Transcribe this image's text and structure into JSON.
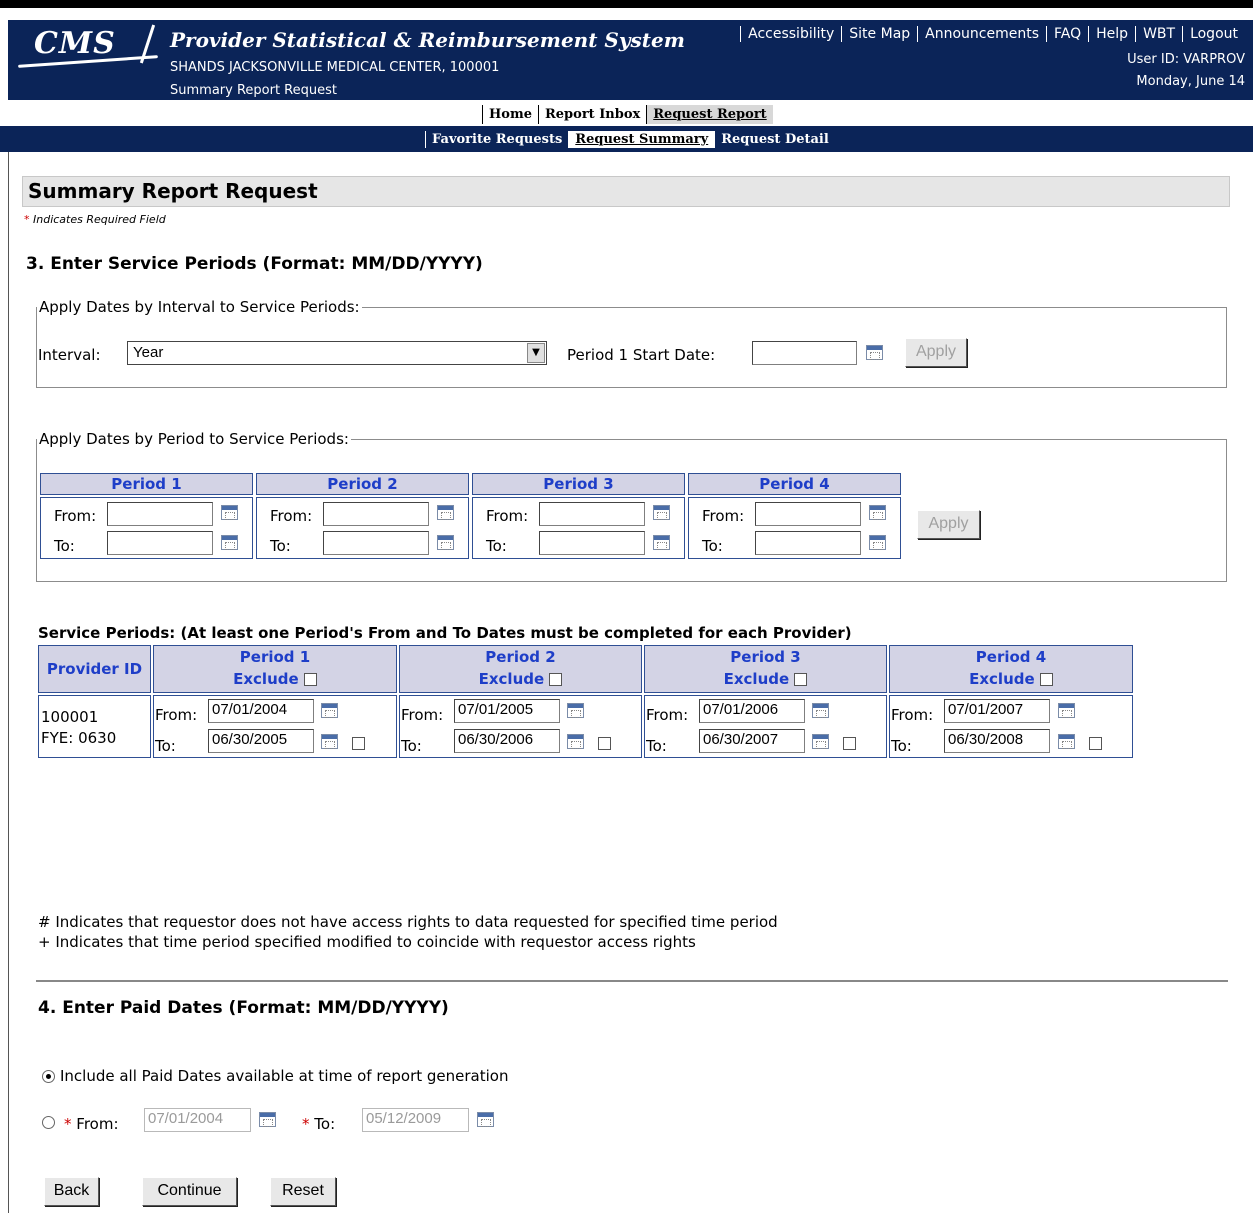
{
  "header": {
    "logo": "CMS",
    "app_title": "Provider Statistical & Reimbursement System",
    "facility": "SHANDS JACKSONVILLE MEDICAL CENTER, 100001",
    "crumb": "Summary Report Request",
    "util_links": [
      "Accessibility",
      "Site Map",
      "Announcements",
      "FAQ",
      "Help",
      "WBT",
      "Logout"
    ],
    "user_id": "User ID: VARPROV",
    "date": "Monday, June 14"
  },
  "nav1": [
    "Home",
    "Report Inbox",
    "Request Report"
  ],
  "nav2": [
    "Favorite Requests",
    "Request Summary",
    "Request Detail"
  ],
  "page": {
    "title": "Summary Report Request",
    "required_note": "Indicates Required Field",
    "section3": "3.  Enter Service Periods (Format: MM/DD/YYYY)",
    "interval_legend": "Apply Dates by Interval to Service Periods:",
    "interval_label": "Interval:",
    "interval_value": "Year",
    "period1_start_label": "Period 1 Start Date:",
    "apply_label": "Apply",
    "period_legend": "Apply Dates by Period to Service Periods:",
    "periods": [
      "Period 1",
      "Period 2",
      "Period 3",
      "Period 4"
    ],
    "from_label": "From:",
    "to_label": "To:",
    "service_periods_caption": "Service Periods: (At least one Period's From and To Dates must be completed for each Provider)",
    "provider_id_header": "Provider ID",
    "exclude_label": "Exclude",
    "provider_id": "100001",
    "fye": "FYE: 0630",
    "service_dates": [
      {
        "from": "07/01/2004",
        "to": "06/30/2005"
      },
      {
        "from": "07/01/2005",
        "to": "06/30/2006"
      },
      {
        "from": "07/01/2006",
        "to": "06/30/2007"
      },
      {
        "from": "07/01/2007",
        "to": "06/30/2008"
      }
    ],
    "note_hash": "# Indicates that requestor does not have access rights to data requested for specified time period",
    "note_plus": "+ Indicates that time period specified modified to coincide with requestor access rights",
    "section4": "4.  Enter Paid Dates (Format: MM/DD/YYYY)",
    "include_all_label": "Include all Paid Dates available at time of report generation",
    "paid_from_label": "From:",
    "paid_to_label": "To:",
    "paid_from_value": "07/01/2004",
    "paid_to_value": "05/12/2009",
    "back_label": "Back",
    "continue_label": "Continue",
    "reset_label": "Reset"
  }
}
